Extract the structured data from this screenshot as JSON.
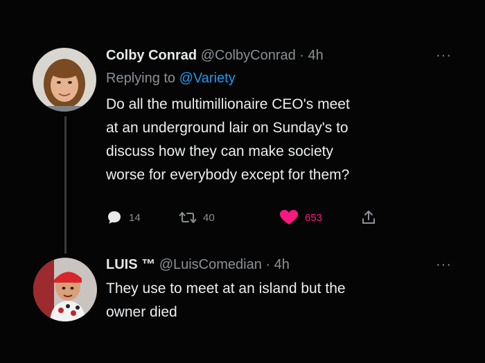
{
  "tweet1": {
    "display_name": "Colby Conrad",
    "handle": "@ColbyConrad",
    "separator": "·",
    "time": "4h",
    "more": "···",
    "replying_prefix": "Replying to",
    "replying_to": "@Variety",
    "text": "Do all the multimillionaire CEO's meet\nat an underground lair on Sunday's to\ndiscuss how they can make society\nworse for everybody except for them?",
    "actions": {
      "replies": "14",
      "retweets": "40",
      "likes": "653"
    }
  },
  "tweet2": {
    "display_name": "LUIS ™",
    "handle": "@LuisComedian",
    "separator": "·",
    "time": "4h",
    "more": "···",
    "text": "They use to meet at an island but the\nowner died"
  },
  "icons": {
    "reply": "speech-bubble-icon",
    "retweet": "retweet-arrows-icon",
    "like": "heart-icon",
    "share": "share-upload-icon"
  },
  "colors": {
    "background": "#000000",
    "text": "#e7e9ea",
    "secondary": "#8b9096",
    "mention": "#1d9bf0",
    "like": "#f91880"
  }
}
